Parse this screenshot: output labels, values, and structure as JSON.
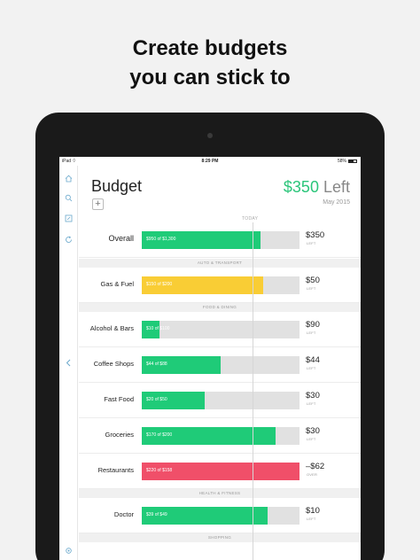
{
  "headline": {
    "line1": "Create budgets",
    "line2": "you can stick to"
  },
  "statusbar": {
    "carrier": "iPad",
    "wifi_icon": "wifi-icon",
    "time": "8:29 PM",
    "battery_pct": "58%"
  },
  "sidebar": {
    "icons": [
      "home-icon",
      "search-icon",
      "edit-icon",
      "refresh-icon",
      "back-chevron-icon",
      "settings-icon"
    ]
  },
  "header": {
    "title": "Budget",
    "add_label": "+",
    "left_amount": "$350",
    "left_word": "Left",
    "month": "May 2015"
  },
  "today_label": "TODAY",
  "rows": [
    {
      "label": "Overall",
      "bar_text": "$950 of $1,300",
      "fill": 0.75,
      "color": "#1fcb78",
      "amount": "$350",
      "sub": "LEFT"
    },
    {
      "label": "Gas & Fuel",
      "bar_text": "$150 of $200",
      "fill": 0.77,
      "color": "#f9cd35",
      "amount": "$50",
      "sub": "LEFT"
    },
    {
      "label": "Alcohol & Bars",
      "bar_text": "$10 of $100",
      "fill": 0.11,
      "color": "#1fcb78",
      "amount": "$90",
      "sub": "LEFT"
    },
    {
      "label": "Coffee Shops",
      "bar_text": "$44 of $88",
      "fill": 0.5,
      "color": "#1fcb78",
      "amount": "$44",
      "sub": "LEFT"
    },
    {
      "label": "Fast Food",
      "bar_text": "$20 of $50",
      "fill": 0.4,
      "color": "#1fcb78",
      "amount": "$30",
      "sub": "LEFT"
    },
    {
      "label": "Groceries",
      "bar_text": "$170 of $200",
      "fill": 0.85,
      "color": "#1fcb78",
      "amount": "$30",
      "sub": "LEFT"
    },
    {
      "label": "Restaurants",
      "bar_text": "$220 of $158",
      "fill": 1.0,
      "color": "#f04f69",
      "amount": "–$62",
      "sub": "OVER"
    },
    {
      "label": "Doctor",
      "bar_text": "$39 of $49",
      "fill": 0.8,
      "color": "#1fcb78",
      "amount": "$10",
      "sub": "LEFT"
    }
  ],
  "sections": [
    "AUTO & TRANSPORT",
    "FOOD & DINING",
    "HEALTH & FITNESS",
    "SHOPPING"
  ]
}
